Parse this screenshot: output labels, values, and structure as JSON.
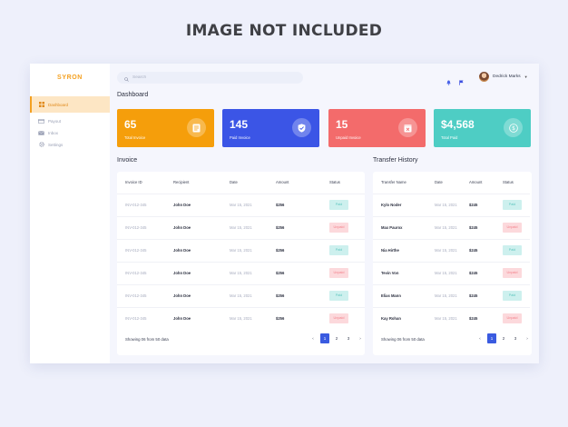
{
  "banner": "IMAGE NOT INCLUDED",
  "brand": "SYRON",
  "sidebar": {
    "items": [
      {
        "label": "Dashboard",
        "icon": "grid-icon"
      },
      {
        "label": "Payout",
        "icon": "card-icon"
      },
      {
        "label": "Inbox",
        "icon": "mail-icon"
      },
      {
        "label": "Settings",
        "icon": "gear-icon"
      }
    ]
  },
  "search": {
    "placeholder": "Search"
  },
  "user": {
    "name": "Dedrick Marks"
  },
  "page_title": "Dashboard",
  "stats": [
    {
      "value": "65",
      "label": "Total Invoice",
      "color": "#f59e0b"
    },
    {
      "value": "145",
      "label": "Paid Invoice",
      "color": "#3b55e6"
    },
    {
      "value": "15",
      "label": "Unpaid Invoice",
      "color": "#f36b6b"
    },
    {
      "value": "$4,568",
      "label": "Total Paid",
      "color": "#4ecdc4"
    }
  ],
  "invoice": {
    "title": "Invoice",
    "columns": [
      "Invoice ID",
      "Recipient",
      "Date",
      "Amount",
      "Status"
    ],
    "rows": [
      {
        "id": "INV-012-345",
        "recipient": "John Doe",
        "date": "Mar 15, 2021",
        "amount": "$256",
        "status": "Paid"
      },
      {
        "id": "INV-012-345",
        "recipient": "John Doe",
        "date": "Mar 15, 2021",
        "amount": "$256",
        "status": "Unpaid"
      },
      {
        "id": "INV-012-345",
        "recipient": "John Doe",
        "date": "Mar 15, 2021",
        "amount": "$256",
        "status": "Paid"
      },
      {
        "id": "INV-012-345",
        "recipient": "John Doe",
        "date": "Mar 15, 2021",
        "amount": "$256",
        "status": "Unpaid"
      },
      {
        "id": "INV-012-345",
        "recipient": "John Doe",
        "date": "Mar 15, 2021",
        "amount": "$256",
        "status": "Paid"
      },
      {
        "id": "INV-012-345",
        "recipient": "John Doe",
        "date": "Mar 15, 2021",
        "amount": "$256",
        "status": "Unpaid"
      }
    ],
    "footer": "Showing 06 from 50 data",
    "pages": [
      "1",
      "2",
      "3"
    ]
  },
  "transfer": {
    "title": "Transfer History",
    "columns": [
      "Transfer Name",
      "Date",
      "Amount",
      "Status"
    ],
    "rows": [
      {
        "name": "Kylo Noder",
        "date": "Mar 15, 2021",
        "amount": "$245",
        "status": "Paid"
      },
      {
        "name": "Max Paurox",
        "date": "Mar 15, 2021",
        "amount": "$245",
        "status": "Unpaid"
      },
      {
        "name": "Nia Hirthe",
        "date": "Mar 15, 2021",
        "amount": "$245",
        "status": "Paid"
      },
      {
        "name": "Tevin Von",
        "date": "Mar 15, 2021",
        "amount": "$245",
        "status": "Unpaid"
      },
      {
        "name": "Elias Mann",
        "date": "Mar 15, 2021",
        "amount": "$245",
        "status": "Paid"
      },
      {
        "name": "Kay Rohan",
        "date": "Mar 15, 2021",
        "amount": "$245",
        "status": "Unpaid"
      }
    ],
    "footer": "Showing 06 from 50 data",
    "pages": [
      "1",
      "2",
      "3"
    ]
  }
}
